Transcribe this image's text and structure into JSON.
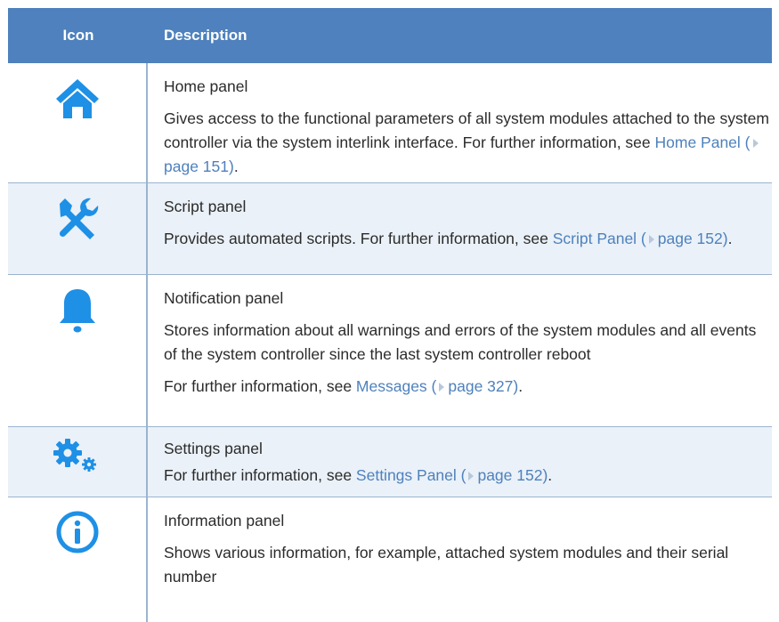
{
  "header": {
    "col_icon": "Icon",
    "col_description": "Description"
  },
  "colors": {
    "header_bg": "#4e81bd",
    "icon": "#1e90e6",
    "link": "#4e81bd",
    "alt_row": "#eaf1f8"
  },
  "rows": [
    {
      "icon": "home-icon",
      "title": "Home panel",
      "body": "Gives access to the functional parameters of all system modules attached to the system controller via the system interlink interface.",
      "ref_prefix": "For further information, see ",
      "ref_link": "Home Panel (",
      "ref_page": "page 151)",
      "ref_suffix": "."
    },
    {
      "icon": "tools-icon",
      "title": "Script panel",
      "body": "Provides automated scripts. For further information, see ",
      "ref_link": "Script Panel (",
      "ref_page": "page 152)",
      "ref_suffix": "."
    },
    {
      "icon": "bell-icon",
      "title": "Notification panel",
      "body": "Stores information about all warnings and errors of the system modules and all events of the system controller since the last system controller reboot",
      "ref_prefix": "For further information, see ",
      "ref_link": "Messages (",
      "ref_page": "page 327)",
      "ref_suffix": "."
    },
    {
      "icon": "gears-icon",
      "title": "Settings panel",
      "ref_prefix": "For further information, see ",
      "ref_link": "Settings Panel (",
      "ref_page": "page 152)",
      "ref_suffix": "."
    },
    {
      "icon": "info-icon",
      "title": "Information panel",
      "body": "Shows various information, for example, attached system modules and their serial number"
    }
  ]
}
